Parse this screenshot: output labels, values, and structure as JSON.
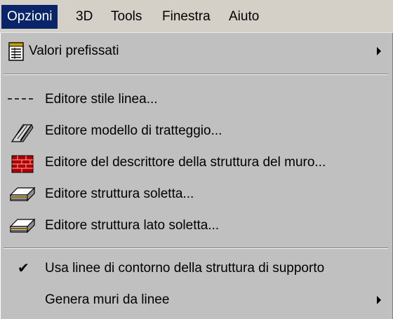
{
  "menubar": {
    "items": [
      {
        "label": "Opzioni",
        "active": true
      },
      {
        "label": "3D"
      },
      {
        "label": "Tools"
      },
      {
        "label": "Finestra"
      },
      {
        "label": "Aiuto"
      }
    ]
  },
  "menu": {
    "items": [
      {
        "label": "Valori prefissati",
        "icon": "preset-table-icon",
        "submenu": true
      },
      {
        "label": "Editore stile linea...",
        "icon": "dashed-line-icon"
      },
      {
        "label": "Editore modello di tratteggio...",
        "icon": "hatch-pattern-icon"
      },
      {
        "label": "Editore del descrittore della struttura del muro...",
        "icon": "brick-wall-icon"
      },
      {
        "label": "Editore struttura soletta...",
        "icon": "slab-structure-icon"
      },
      {
        "label": "Editore struttura lato soletta...",
        "icon": "slab-side-structure-icon"
      },
      {
        "label": "Usa linee di contorno della struttura di supporto",
        "icon": "checkmark-icon",
        "checked": true
      },
      {
        "label": "Genera muri da linee",
        "submenu": true
      }
    ]
  },
  "colors": {
    "menu_bg": "#c0c0c0",
    "highlight": "#0a246a",
    "highlight_text": "#ffffff"
  }
}
